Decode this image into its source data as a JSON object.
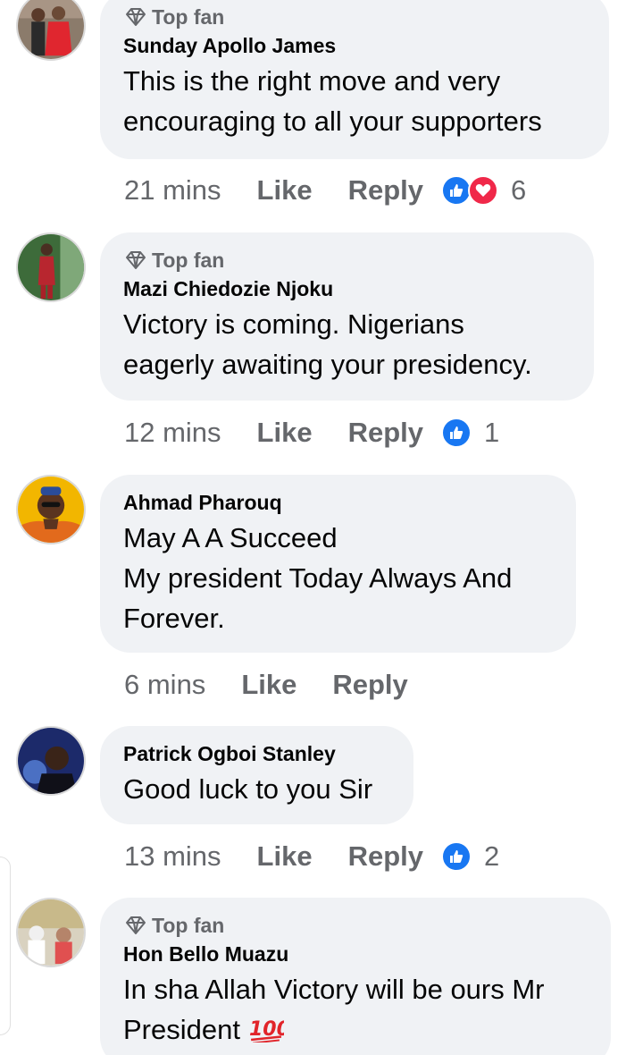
{
  "comments": [
    {
      "badge": "Top fan",
      "author": "Sunday Apollo James",
      "lines": [
        "This is the right move and very",
        "encouraging to all your supporters"
      ],
      "time": "21 mins",
      "like_label": "Like",
      "reply_label": "Reply",
      "reactions": [
        "like",
        "love"
      ],
      "reaction_count": "6"
    },
    {
      "badge": "Top fan",
      "author": "Mazi Chiedozie Njoku",
      "lines": [
        "Victory is coming. Nigerians",
        "eagerly awaiting your presidency."
      ],
      "time": "12 mins",
      "like_label": "Like",
      "reply_label": "Reply",
      "reactions": [
        "like"
      ],
      "reaction_count": "1"
    },
    {
      "author": "Ahmad Pharouq",
      "lines": [
        "May A A Succeed",
        "My president Today Always And",
        "Forever."
      ],
      "time": "6 mins",
      "like_label": "Like",
      "reply_label": "Reply"
    },
    {
      "author": "Patrick Ogboi Stanley",
      "lines": [
        "Good luck to you Sir"
      ],
      "time": "13 mins",
      "like_label": "Like",
      "reply_label": "Reply",
      "reactions": [
        "like"
      ],
      "reaction_count": "2"
    },
    {
      "badge": "Top fan",
      "author": "Hon Bello Muazu",
      "lines": [
        "In sha Allah Victory will be ours Mr",
        "President"
      ],
      "trailing_emoji": "💯"
    }
  ],
  "colors": {
    "bubble": "#f0f2f5",
    "meta_text": "#65676b",
    "like_reaction": "#1877f2",
    "love_reaction": "#f02849"
  },
  "icons": {
    "badge": "diamond-icon",
    "like_reaction": "thumbs-up-icon",
    "love_reaction": "heart-icon",
    "emoji": "hundred-points-emoji"
  }
}
